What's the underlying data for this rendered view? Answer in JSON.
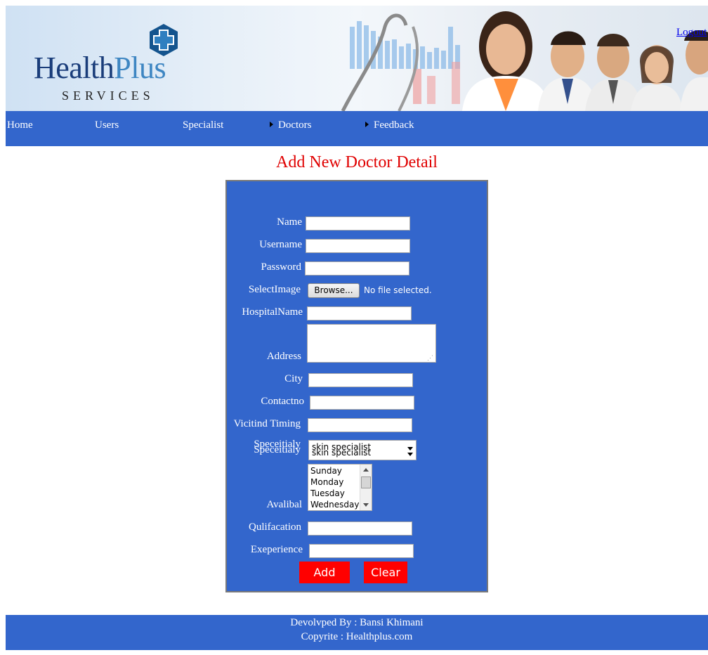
{
  "header": {
    "logo": {
      "word_part1": "Health",
      "word_part2": "Plus",
      "tagline": "SERVICES"
    },
    "logout_link": "Logout"
  },
  "nav": {
    "items": [
      {
        "label": "Home",
        "has_arrow": false
      },
      {
        "label": "Users",
        "has_arrow": false
      },
      {
        "label": "Specialist",
        "has_arrow": false
      },
      {
        "label": "Doctors",
        "has_arrow": true
      },
      {
        "label": "Feedback",
        "has_arrow": true
      }
    ]
  },
  "page": {
    "title": "Add New Doctor Detail"
  },
  "form": {
    "fields": {
      "name": {
        "label": "Name",
        "value": ""
      },
      "username": {
        "label": "Username",
        "value": ""
      },
      "password": {
        "label": "Password",
        "value": ""
      },
      "select_image": {
        "label": "SelectImage",
        "button": "Browse...",
        "status": "No file selected."
      },
      "hospital_name": {
        "label": "HospitalName",
        "value": ""
      },
      "address": {
        "label": "Address",
        "value": ""
      },
      "city": {
        "label": "City",
        "value": ""
      },
      "contact_no": {
        "label": "Contactno",
        "value": ""
      },
      "visiting_timing": {
        "label": "Vicitind Timing",
        "value": ""
      },
      "specialty": {
        "label": "Speceitialy",
        "selected": "skin specialist"
      },
      "available": {
        "label": "Avalibal",
        "options": [
          "Sunday",
          "Monday",
          "Tuesday",
          "Wednesday"
        ]
      },
      "qualification": {
        "label": "Qulifacation",
        "value": ""
      },
      "experience": {
        "label": "Exeperience",
        "value": ""
      }
    },
    "buttons": {
      "add": "Add",
      "clear": "Clear"
    }
  },
  "footer": {
    "developed_by": "Devolvped By : Bansi Khimani",
    "copyright": "Copyrite : Healthplus.com"
  },
  "colors": {
    "nav_bg": "#3366cc",
    "title": "#e00000",
    "button_bg": "#ff0000"
  }
}
